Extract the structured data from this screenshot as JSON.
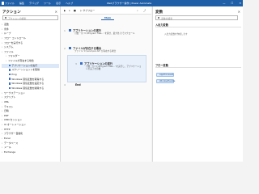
{
  "titlebar": {
    "menu": [
      "ファイル",
      "編集",
      "デバッグ",
      "ツール",
      "表示",
      "ヘルプ"
    ],
    "title": "Webブラウザー操作 | Power Automate",
    "win": [
      "—",
      "☐",
      "✕"
    ]
  },
  "actions_panel": {
    "title": "アクション",
    "search_placeholder": "アクションの検索",
    "items": [
      {
        "label": "変数",
        "level": 0
      },
      {
        "label": "条件",
        "level": 0
      },
      {
        "label": "ループ",
        "level": 0
      },
      {
        "label": "フロー コントロール",
        "level": 0
      },
      {
        "label": "フローを実行する",
        "level": 0
      },
      {
        "label": "システム",
        "level": 0
      },
      {
        "label": "ファイル",
        "level": 0
      },
      {
        "label": "フォルダー",
        "level": 1
      },
      {
        "label": "ファイルが存在する場合",
        "level": 1
      },
      {
        "label": "アプリケーションの実行",
        "level": 2
      },
      {
        "label": "スクリーンショットを取得",
        "level": 2
      },
      {
        "label": "Ping",
        "level": 2
      },
      {
        "label": "Windows 環境変数を取得する",
        "level": 2
      },
      {
        "label": "Windows 環境変数を設定する",
        "level": 2
      },
      {
        "label": "Windows 環境変数を削除する",
        "level": 2
      },
      {
        "label": "ワークステーション",
        "level": 0
      },
      {
        "label": "スクリプト",
        "level": 0
      },
      {
        "label": "XML",
        "level": 0
      },
      {
        "label": "テキスト",
        "level": 0
      },
      {
        "label": "日時",
        "level": 0
      },
      {
        "label": "PDF",
        "level": 0
      },
      {
        "label": "CMD セッション",
        "level": 0
      },
      {
        "label": "UI オートメーション",
        "level": 0
      },
      {
        "label": "HTTP",
        "level": 0
      },
      {
        "label": "ブラウザー自動化",
        "level": 0
      },
      {
        "label": "Excel",
        "level": 0
      },
      {
        "label": "データベース",
        "level": 0
      },
      {
        "label": "メール",
        "level": 0
      },
      {
        "label": "Exchange",
        "level": 0
      }
    ]
  },
  "center": {
    "toolbar": [
      "▶",
      "⏸",
      "■",
      "▷ サブフロー",
      "⌕",
      "⤴"
    ],
    "tabs": [
      "Main"
    ],
    "steps": [
      {
        "num": "1",
        "title": "アプリケーションの実行",
        "desc": "引数 '' の 'C:\\Program Files...' を開き、最大化 までスクロール"
      },
      {
        "num": "2",
        "title": "ファイルが存在する場合",
        "desc": "ファイル 'C:\\xxxx\\xxx.txt' が存在する場合"
      },
      {
        "num": "3",
        "title": "アプリケーションの実行",
        "desc": "引数 '' の 'C:\\Program Files...' を実行し、アプリケーションの完了を待機"
      },
      {
        "num": "4",
        "title": "End",
        "desc": ""
      }
    ]
  },
  "vars_panel": {
    "title": "変数",
    "search_placeholder": "変数の検索",
    "input_section": "入出力変数",
    "input_empty": "入出力変数を作成します",
    "flow_section": "フロー変数",
    "flow_vars": [
      "AppProcessId",
      "WindowHandle"
    ]
  }
}
